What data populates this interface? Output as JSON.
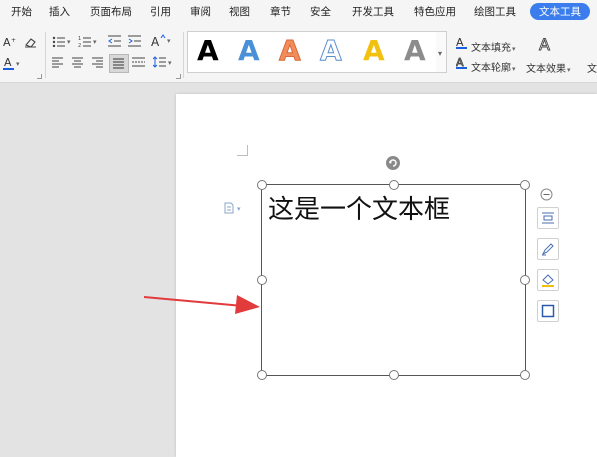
{
  "menu": {
    "tabs": [
      {
        "label": "开始"
      },
      {
        "label": "插入"
      },
      {
        "label": "页面布局"
      },
      {
        "label": "引用"
      },
      {
        "label": "审阅"
      },
      {
        "label": "视图"
      },
      {
        "label": "章节"
      },
      {
        "label": "安全"
      },
      {
        "label": "开发工具"
      },
      {
        "label": "特色应用"
      },
      {
        "label": "绘图工具"
      },
      {
        "label": "文本工具",
        "active": true
      }
    ]
  },
  "ribbon": {
    "text_fill_label": "文本填充",
    "text_outline_label": "文本轮廓",
    "text_effect_label": "文本效果",
    "right_cut_label": "文",
    "gallery_glyph": "A",
    "font_color_glyph": "A",
    "style_colors": [
      "#000000",
      "#4a90d9",
      "#f28c5a",
      "#ffffff",
      "#f2c00f",
      "#8c8c8c"
    ],
    "underline_color": "#1a5fe0"
  },
  "document": {
    "textbox_text": "这是一个文本框"
  },
  "colors": {
    "accent": "#3b7dec",
    "arrow": "#e23b3b"
  }
}
